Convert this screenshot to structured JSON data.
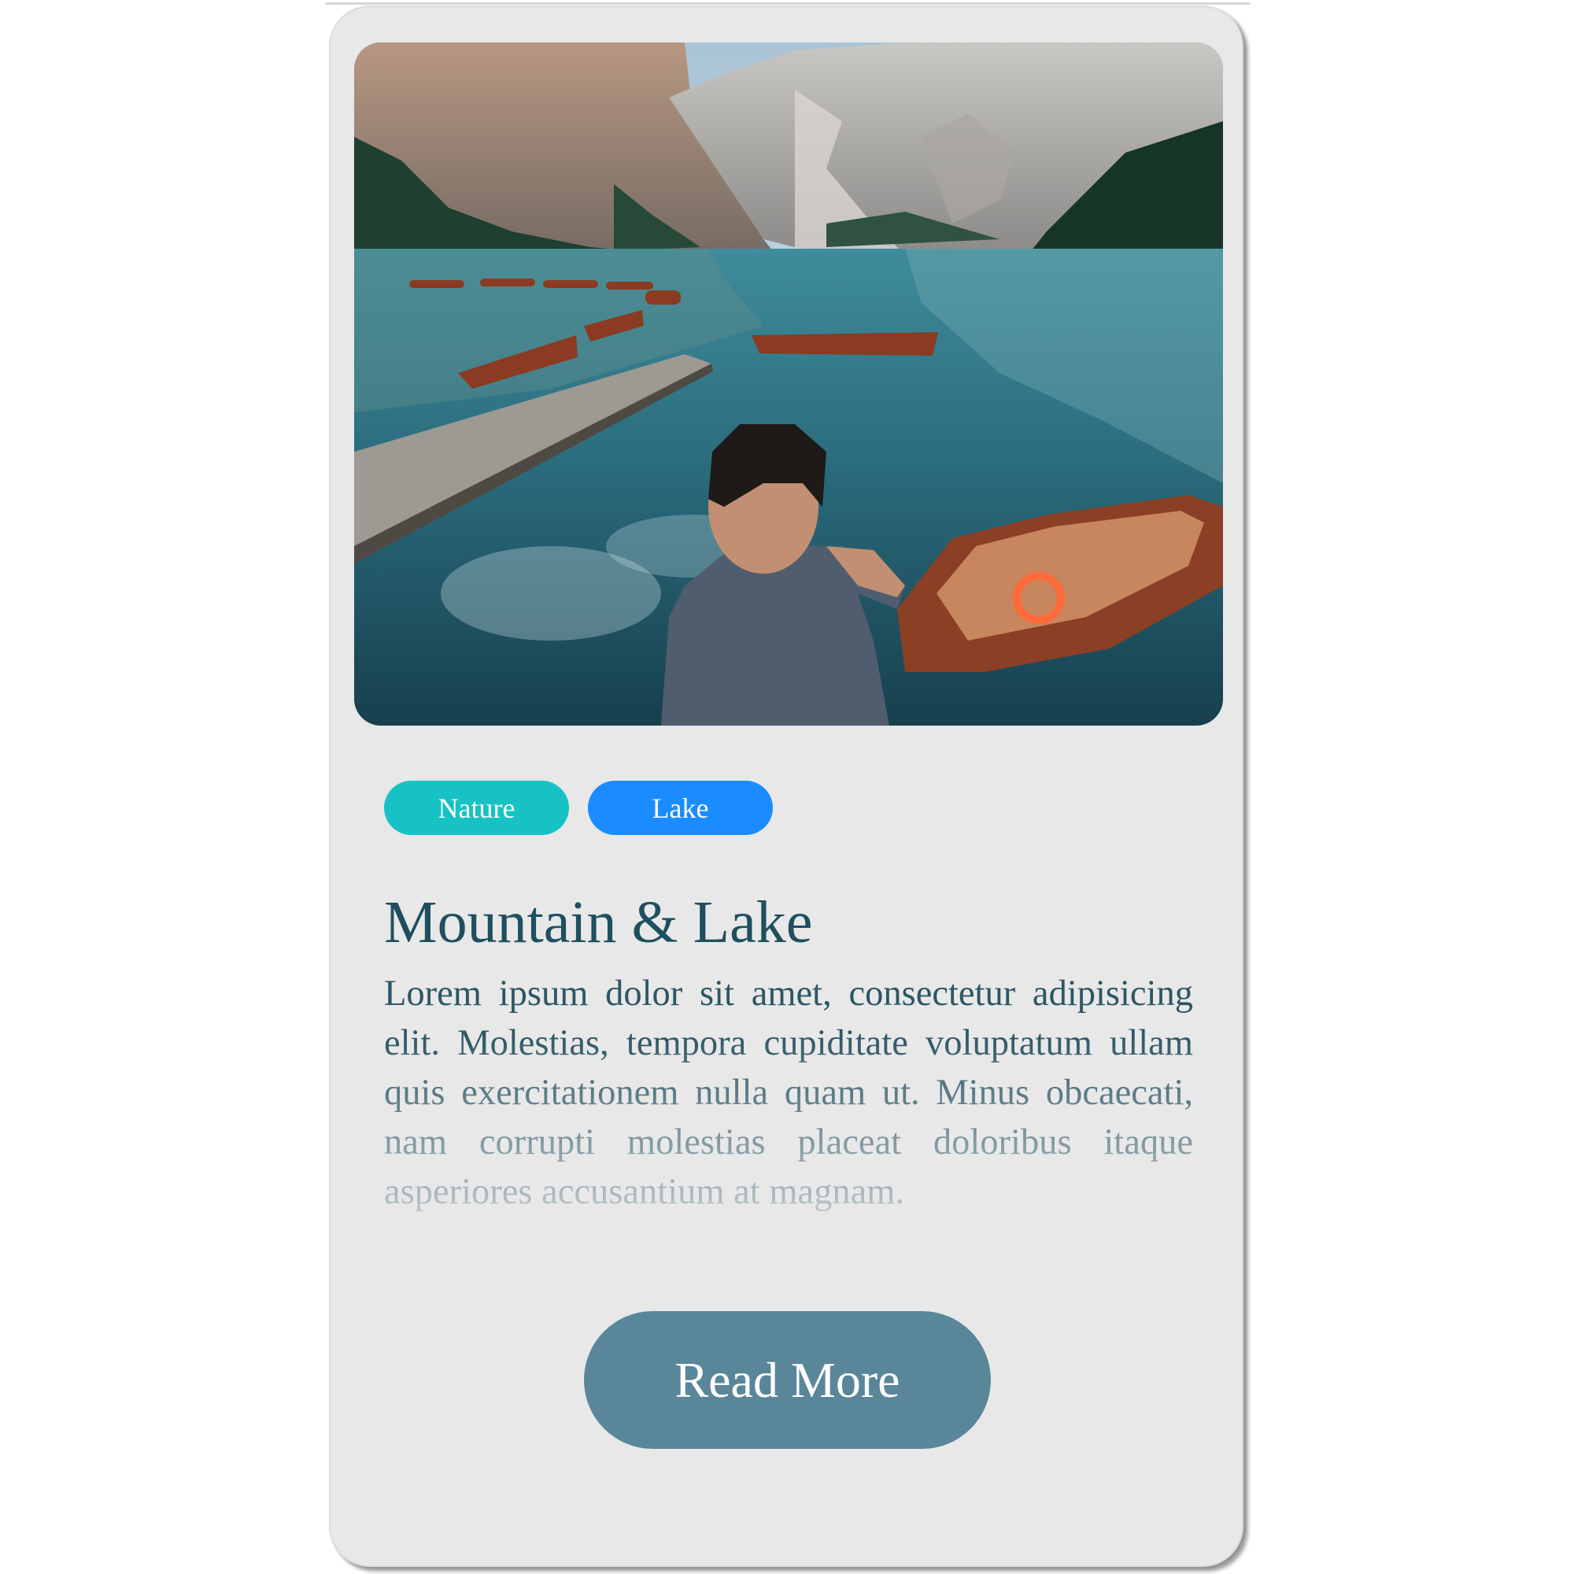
{
  "card": {
    "image": {
      "alt": "Person sitting on a wooden dock looking at a mountain lake with rowing boats",
      "icon": "landscape-photo"
    },
    "tags": [
      {
        "label": "Nature",
        "color": "#17c2c4"
      },
      {
        "label": "Lake",
        "color": "#1a8cff"
      }
    ],
    "title": "Mountain & Lake",
    "description": "Lorem ipsum dolor sit amet, consectetur adipisicing elit. Molestias, tempora cupiditate voluptatum ullam quis exercitationem nulla quam ut. Minus obcaecati, nam corrupti molestias placeat doloribus itaque asperiores accusantium at magnam.",
    "read_more_label": "Read More",
    "colors": {
      "card_background": "#e8e8e9",
      "title_text": "#1f4f5e",
      "button": "#5a8699"
    }
  }
}
